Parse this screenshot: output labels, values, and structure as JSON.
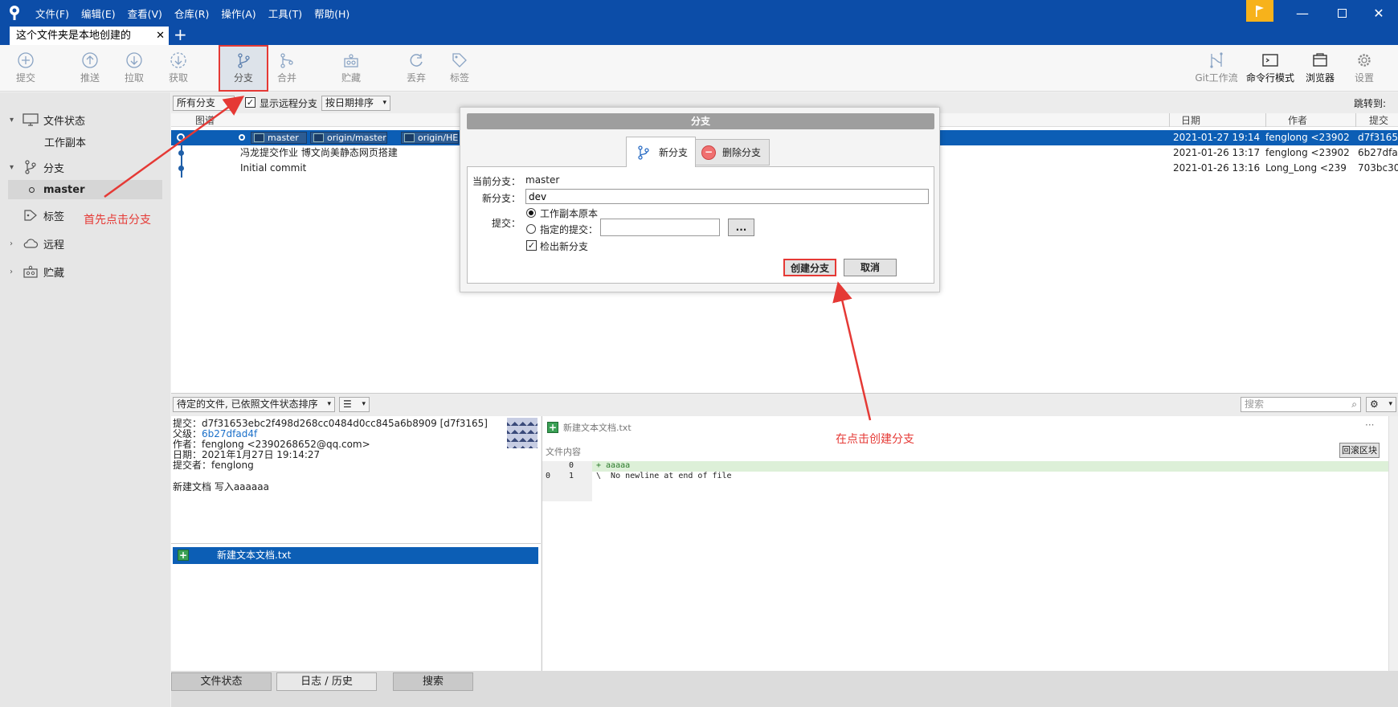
{
  "menu": [
    "文件(F)",
    "编辑(E)",
    "查看(V)",
    "仓库(R)",
    "操作(A)",
    "工具(T)",
    "帮助(H)"
  ],
  "tab": {
    "title": "这个文件夹是本地创建的"
  },
  "toolbar": {
    "commit": "提交",
    "push": "推送",
    "pull": "拉取",
    "fetch": "获取",
    "branch": "分支",
    "merge": "合并",
    "stash": "贮藏",
    "discard": "丢弃",
    "tag": "标签",
    "gitflow": "Git工作流",
    "terminal": "命令行模式",
    "explorer": "浏览器",
    "settings": "设置"
  },
  "sidebar": {
    "file_status": "文件状态",
    "working_copy": "工作副本",
    "branches": "分支",
    "master": "master",
    "tags": "标签",
    "remotes": "远程",
    "stashes": "贮藏"
  },
  "filter": {
    "all_branches": "所有分支",
    "show_remote": "显示远程分支",
    "sort_by_date": "按日期排序",
    "jump_to": "跳转到:"
  },
  "columns": {
    "graph": "图谱",
    "date": "日期",
    "author": "作者",
    "commit": "提交"
  },
  "commits": [
    {
      "tags": [
        "master",
        "origin/master",
        "origin/HE"
      ],
      "date": "2021-01-27 19:14",
      "author": "fenglong <23902",
      "hash": "d7f3165"
    },
    {
      "message": "冯龙提交作业  博文尚美静态网页搭建",
      "date": "2021-01-26 13:17",
      "author": "fenglong <23902",
      "hash": "6b27dfa"
    },
    {
      "message": "Initial commit",
      "date": "2021-01-26 13:16",
      "author": "Long_Long <239",
      "hash": "703bc30"
    }
  ],
  "lower": {
    "pending_sort": "待定的文件, 已依照文件状态排序",
    "search_placeholder": "搜索"
  },
  "commit_info": {
    "commit": "提交：d7f31653ebc2f498d268cc0484d0cc845a6b8909 [d7f3165]",
    "parent_label": "父级：",
    "parent": "6b27dfad4f",
    "author": "作者：fenglong <2390268652@qq.com>",
    "date": "日期：2021年1月27日 19:14:27",
    "committer": "提交者：fenglong",
    "message": "新建文档  写入aaaaaa"
  },
  "files": [
    {
      "name": "新建文本文档.txt"
    }
  ],
  "diff": {
    "file": "新建文本文档.txt",
    "header": "文件内容",
    "revert_hunk": "回滚区块",
    "lines": [
      {
        "old": "",
        "new": "0",
        "text": "+ aaaaa"
      },
      {
        "old": "0",
        "new": "1",
        "text": "\\  No newline at end of file"
      }
    ]
  },
  "bottom_tabs": [
    "文件状态",
    "日志 / 历史",
    "搜索"
  ],
  "dialog": {
    "title": "分支",
    "tab_new": "新分支",
    "tab_delete": "删除分支",
    "current_branch_label": "当前分支：",
    "current_branch": "master",
    "new_branch_label": "新分支：",
    "new_branch_value": "dev",
    "commit_label": "提交：",
    "radio_working_copy": "工作副本原本",
    "radio_specified": "指定的提交：",
    "browse": "...",
    "checkout_new": "检出新分支",
    "create": "创建分支",
    "cancel": "取消"
  },
  "annotations": {
    "first": "首先点击分支",
    "then": "在点击创建分支"
  },
  "colors": {
    "title_bar": "#0c4da8",
    "selection": "#0c5eb5",
    "annotation": "#e53935"
  }
}
